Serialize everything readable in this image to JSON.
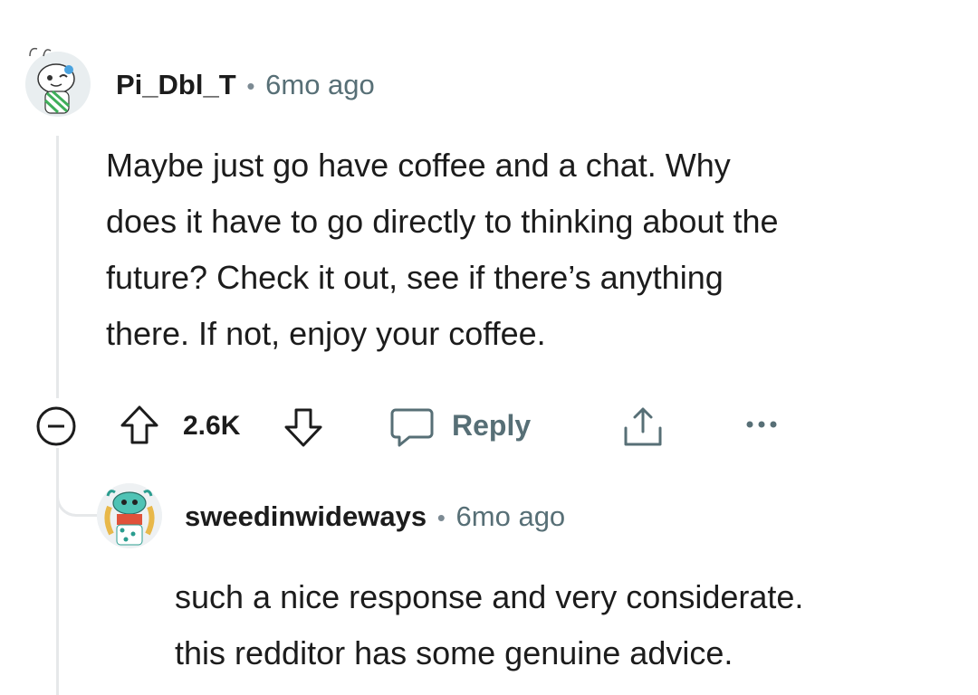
{
  "comment": {
    "username": "Pi_Dbl_T",
    "time": "6mo ago",
    "body_lines": [
      "Maybe just go have coffee and a chat. Why",
      "does it have to go directly to thinking about the",
      "future? Check it out, see if there’s anything",
      "there. If not, enjoy your coffee."
    ],
    "votes": "2.6K",
    "reply_label": "Reply",
    "collapse_icon": "collapse-minus-icon",
    "upvote_icon": "upvote-arrow-icon",
    "downvote_icon": "downvote-arrow-icon",
    "reply_icon": "speech-bubble-icon",
    "share_icon": "share-icon",
    "more_icon": "more-options-icon"
  },
  "reply": {
    "username": "sweedinwideways",
    "time": "6mo ago",
    "body_lines": [
      "such a nice response and very considerate.",
      "this redditor has some genuine advice."
    ]
  },
  "colors": {
    "text": "#1c1c1c",
    "meta": "#576f76",
    "thread_line": "#e6e8ea"
  }
}
